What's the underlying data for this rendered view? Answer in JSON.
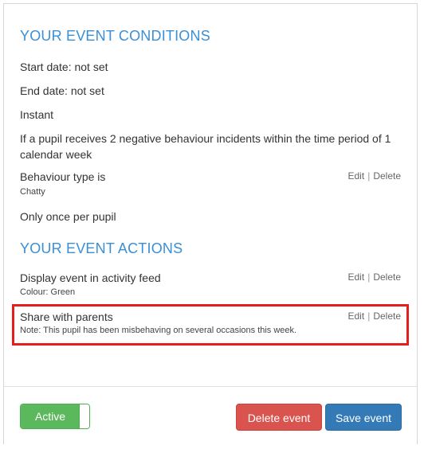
{
  "conditions": {
    "heading": "YOUR EVENT CONDITIONS",
    "start_date": "Start date: not set",
    "end_date": "End date: not set",
    "instant": "Instant",
    "rule": "If a pupil receives 2 negative behaviour incidents within the time period of 1 calendar week",
    "behaviour_type": {
      "label": "Behaviour type is",
      "value": "Chatty",
      "edit": "Edit",
      "separator": "|",
      "delete": "Delete"
    },
    "frequency": "Only once per pupil"
  },
  "actions": {
    "heading": "YOUR EVENT ACTIONS",
    "items": [
      {
        "label": "Display event in activity feed",
        "detail": "Colour: Green",
        "edit": "Edit",
        "separator": "|",
        "delete": "Delete"
      },
      {
        "label": "Share with parents",
        "detail": "Note: This pupil has been misbehaving on several occasions this week.",
        "edit": "Edit",
        "separator": "|",
        "delete": "Delete",
        "highlighted": true
      }
    ]
  },
  "footer": {
    "active_label": "Active",
    "active_state": true,
    "delete_button": "Delete event",
    "save_button": "Save event"
  },
  "colors": {
    "heading": "#3a8fd6",
    "highlight": "#e41e1e",
    "active": "#5cb85c",
    "delete": "#d9534f",
    "save": "#337ab7"
  }
}
